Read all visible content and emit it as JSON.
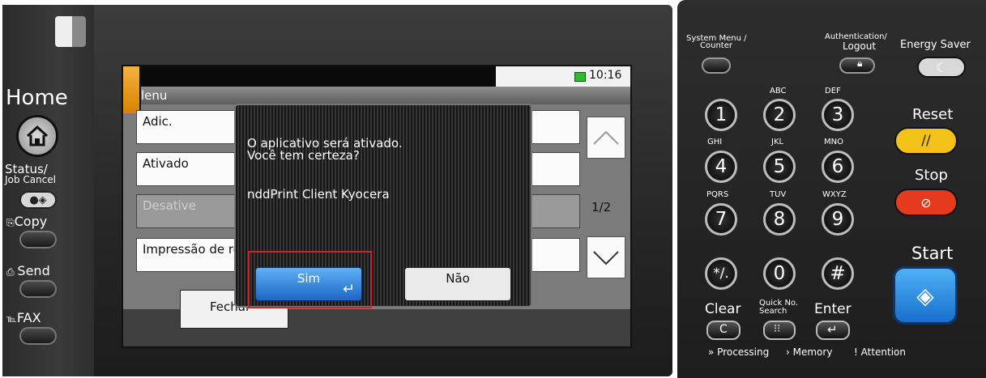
{
  "left_panel": {
    "home_label": "Home",
    "status_label_1": "Status/",
    "status_label_2": "Job Cancel",
    "copy_label": "Copy",
    "send_label": "Send",
    "fax_label": "FAX"
  },
  "screen": {
    "clock": "10:16",
    "title": "lenu",
    "items": [
      "Adic.",
      "Ativado",
      "Desative",
      "Impressão de relatório"
    ],
    "page": "1/2",
    "close_label": "Fechar"
  },
  "dialog": {
    "line1": "O aplicativo será ativado.",
    "line2": "Você tem certeza?",
    "app_name": "nddPrint Client Kyocera",
    "yes_label": "Sim",
    "no_label": "Não"
  },
  "right_panel": {
    "system_menu_1": "System Menu /",
    "system_menu_2": "Counter",
    "auth_1": "Authentication/",
    "auth_2": "Logout",
    "energy": "Energy Saver",
    "keys": [
      "1",
      "2",
      "3",
      "4",
      "5",
      "6",
      "7",
      "8",
      "9",
      "*/.",
      "0",
      "#"
    ],
    "key_letters": [
      "ABC",
      "DEF",
      "GHI",
      "JKL",
      "MNO",
      "PQRS",
      "TUV",
      "WXYZ"
    ],
    "reset": "Reset",
    "stop": "Stop",
    "start": "Start",
    "clear": "Clear",
    "quick_1": "Quick No.",
    "quick_2": "Search",
    "enter": "Enter",
    "processing": "Processing",
    "memory": "Memory",
    "attention": "Attention"
  },
  "colors": {
    "accent_orange": "#f0a02a",
    "reset_yellow": "#f2c21a",
    "stop_red": "#e53a1e",
    "start_blue": "#2a8ee0",
    "yes_blue": "#2f86e0",
    "highlight_red": "#d32020"
  }
}
